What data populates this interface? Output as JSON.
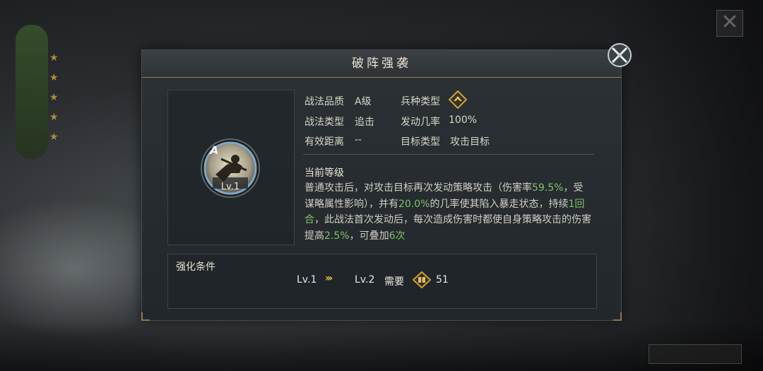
{
  "dialog": {
    "title": "破阵强袭",
    "close_icon": "crossed-swords-close-icon"
  },
  "skill": {
    "grade_letter": "A",
    "level_badge": "Lv.1",
    "icon": "warrior-portrait-icon"
  },
  "attributes": {
    "quality_label": "战法品质",
    "quality_value": "A级",
    "troop_label": "兵种类型",
    "troop_icon": "cavalry-emblem-icon",
    "type_label": "战法类型",
    "type_value": "追击",
    "rate_label": "发动几率",
    "rate_value": "100%",
    "range_label": "有效距离",
    "range_value": "--",
    "target_label": "目标类型",
    "target_value": "攻击目标"
  },
  "current_level": {
    "title": "当前等级",
    "desc_1": "普通攻击后，对攻击目标再次发动策略攻击（伤害率",
    "val_1": "59.5%",
    "desc_2": "，受谋略属性影响），并有",
    "val_2": "20.0%",
    "desc_3": "的几率使其陷入暴走状态，持续",
    "val_3": "1回合",
    "desc_4": "，此战法首次发动后，每次造成伤害时都使自身策略攻击的伤害提高",
    "val_4": "2.5%",
    "desc_5": "，可叠加",
    "val_5": "6次"
  },
  "upgrade": {
    "label": "强化条件",
    "from_level": "Lv.1",
    "arrows": "›››",
    "to_level": "Lv.2",
    "need_label": "需要",
    "cost_icon": "battle-merit-token-icon",
    "cost_value": "51"
  },
  "colors": {
    "highlight": "#7fc36a",
    "accent_gold": "#e2b23a"
  }
}
